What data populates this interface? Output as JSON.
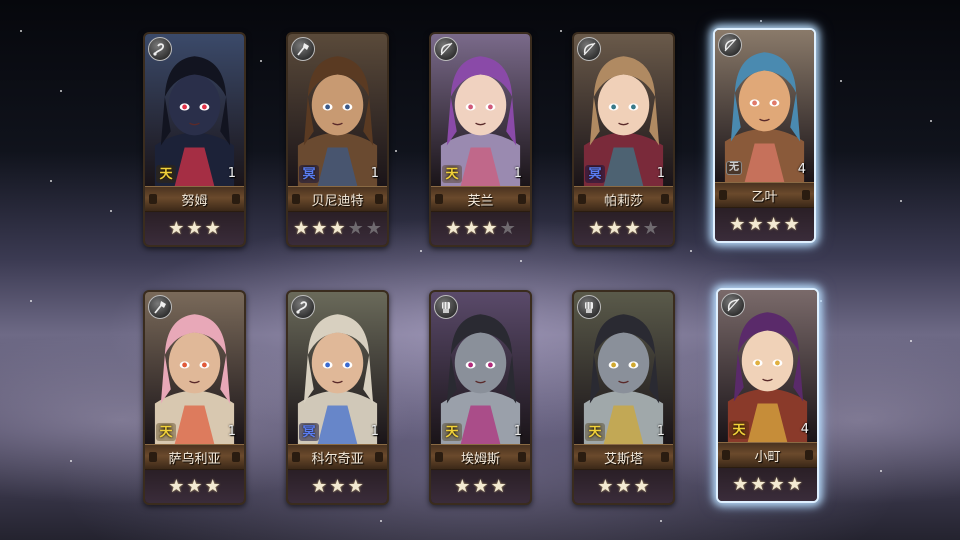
{
  "characters": [
    {
      "name": "努姆",
      "level": "1",
      "element": "天",
      "element_type": "sky",
      "class_icon": "whip-icon",
      "stars_filled": 3,
      "stars_total": 3,
      "selected": false,
      "palette": {
        "bg": "#3b4a6a",
        "main": "#1c2238",
        "accent": "#e0334a",
        "skin": "#2a2f4a",
        "hair": "#121420"
      }
    },
    {
      "name": "贝尼迪特",
      "level": "1",
      "element": "冥",
      "element_type": "nether",
      "class_icon": "axe-icon",
      "stars_filled": 3,
      "stars_total": 5,
      "selected": false,
      "palette": {
        "bg": "#5a4a3a",
        "main": "#6a4a30",
        "accent": "#3b5a8a",
        "skin": "#c89a72",
        "hair": "#5a3a22"
      }
    },
    {
      "name": "芙兰",
      "level": "1",
      "element": "天",
      "element_type": "sky",
      "class_icon": "bow-icon",
      "stars_filled": 3,
      "stars_total": 4,
      "selected": false,
      "palette": {
        "bg": "#7a6a8a",
        "main": "#9a8ab0",
        "accent": "#d05a7a",
        "skin": "#f0d2c0",
        "hair": "#8a4aa8"
      }
    },
    {
      "name": "帕莉莎",
      "level": "1",
      "element": "冥",
      "element_type": "nether",
      "class_icon": "bow-icon",
      "stars_filled": 3,
      "stars_total": 4,
      "selected": false,
      "palette": {
        "bg": "#6a5a4a",
        "main": "#7a2a3a",
        "accent": "#3a7a8a",
        "skin": "#f0d0b8",
        "hair": "#b08a62"
      }
    },
    {
      "name": "乙叶",
      "level": "4",
      "element": "无",
      "element_type": "neutral",
      "class_icon": "bow-icon",
      "stars_filled": 4,
      "stars_total": 4,
      "selected": true,
      "palette": {
        "bg": "#8a7a6a",
        "main": "#8a5a3a",
        "accent": "#e07a6a",
        "skin": "#e0a878",
        "hair": "#4a8ab0"
      }
    },
    {
      "name": "萨乌利亚",
      "level": "1",
      "element": "天",
      "element_type": "sky",
      "class_icon": "axe-icon",
      "stars_filled": 3,
      "stars_total": 3,
      "selected": false,
      "palette": {
        "bg": "#7a6a5a",
        "main": "#d8c8b0",
        "accent": "#e05a3a",
        "skin": "#e0b898",
        "hair": "#e8a8b8"
      }
    },
    {
      "name": "科尔奇亚",
      "level": "1",
      "element": "冥",
      "element_type": "nether",
      "class_icon": "whip-icon",
      "stars_filled": 3,
      "stars_total": 3,
      "selected": false,
      "palette": {
        "bg": "#6a6a5a",
        "main": "#d0c8b8",
        "accent": "#3a6ad0",
        "skin": "#e0b898",
        "hair": "#d8d0c0"
      }
    },
    {
      "name": "埃姆斯",
      "level": "1",
      "element": "天",
      "element_type": "sky",
      "class_icon": "gauntlet-icon",
      "stars_filled": 3,
      "stars_total": 3,
      "selected": false,
      "palette": {
        "bg": "#5a4a6a",
        "main": "#9aa0aa",
        "accent": "#b02a7a",
        "skin": "#8a909a",
        "hair": "#2a2a32"
      }
    },
    {
      "name": "艾斯塔",
      "level": "1",
      "element": "天",
      "element_type": "sky",
      "class_icon": "gauntlet-icon",
      "stars_filled": 3,
      "stars_total": 3,
      "selected": false,
      "palette": {
        "bg": "#5a5a4a",
        "main": "#a0a8aa",
        "accent": "#d0a830",
        "skin": "#8a909a",
        "hair": "#2a2a32"
      }
    },
    {
      "name": "小町",
      "level": "4",
      "element": "天",
      "element_type": "sky",
      "class_icon": "bow-icon",
      "stars_filled": 4,
      "stars_total": 4,
      "selected": true,
      "palette": {
        "bg": "#7a6a6a",
        "main": "#8a3a2a",
        "accent": "#e0b040",
        "skin": "#f0d2b8",
        "hair": "#5a2a6a"
      }
    }
  ]
}
